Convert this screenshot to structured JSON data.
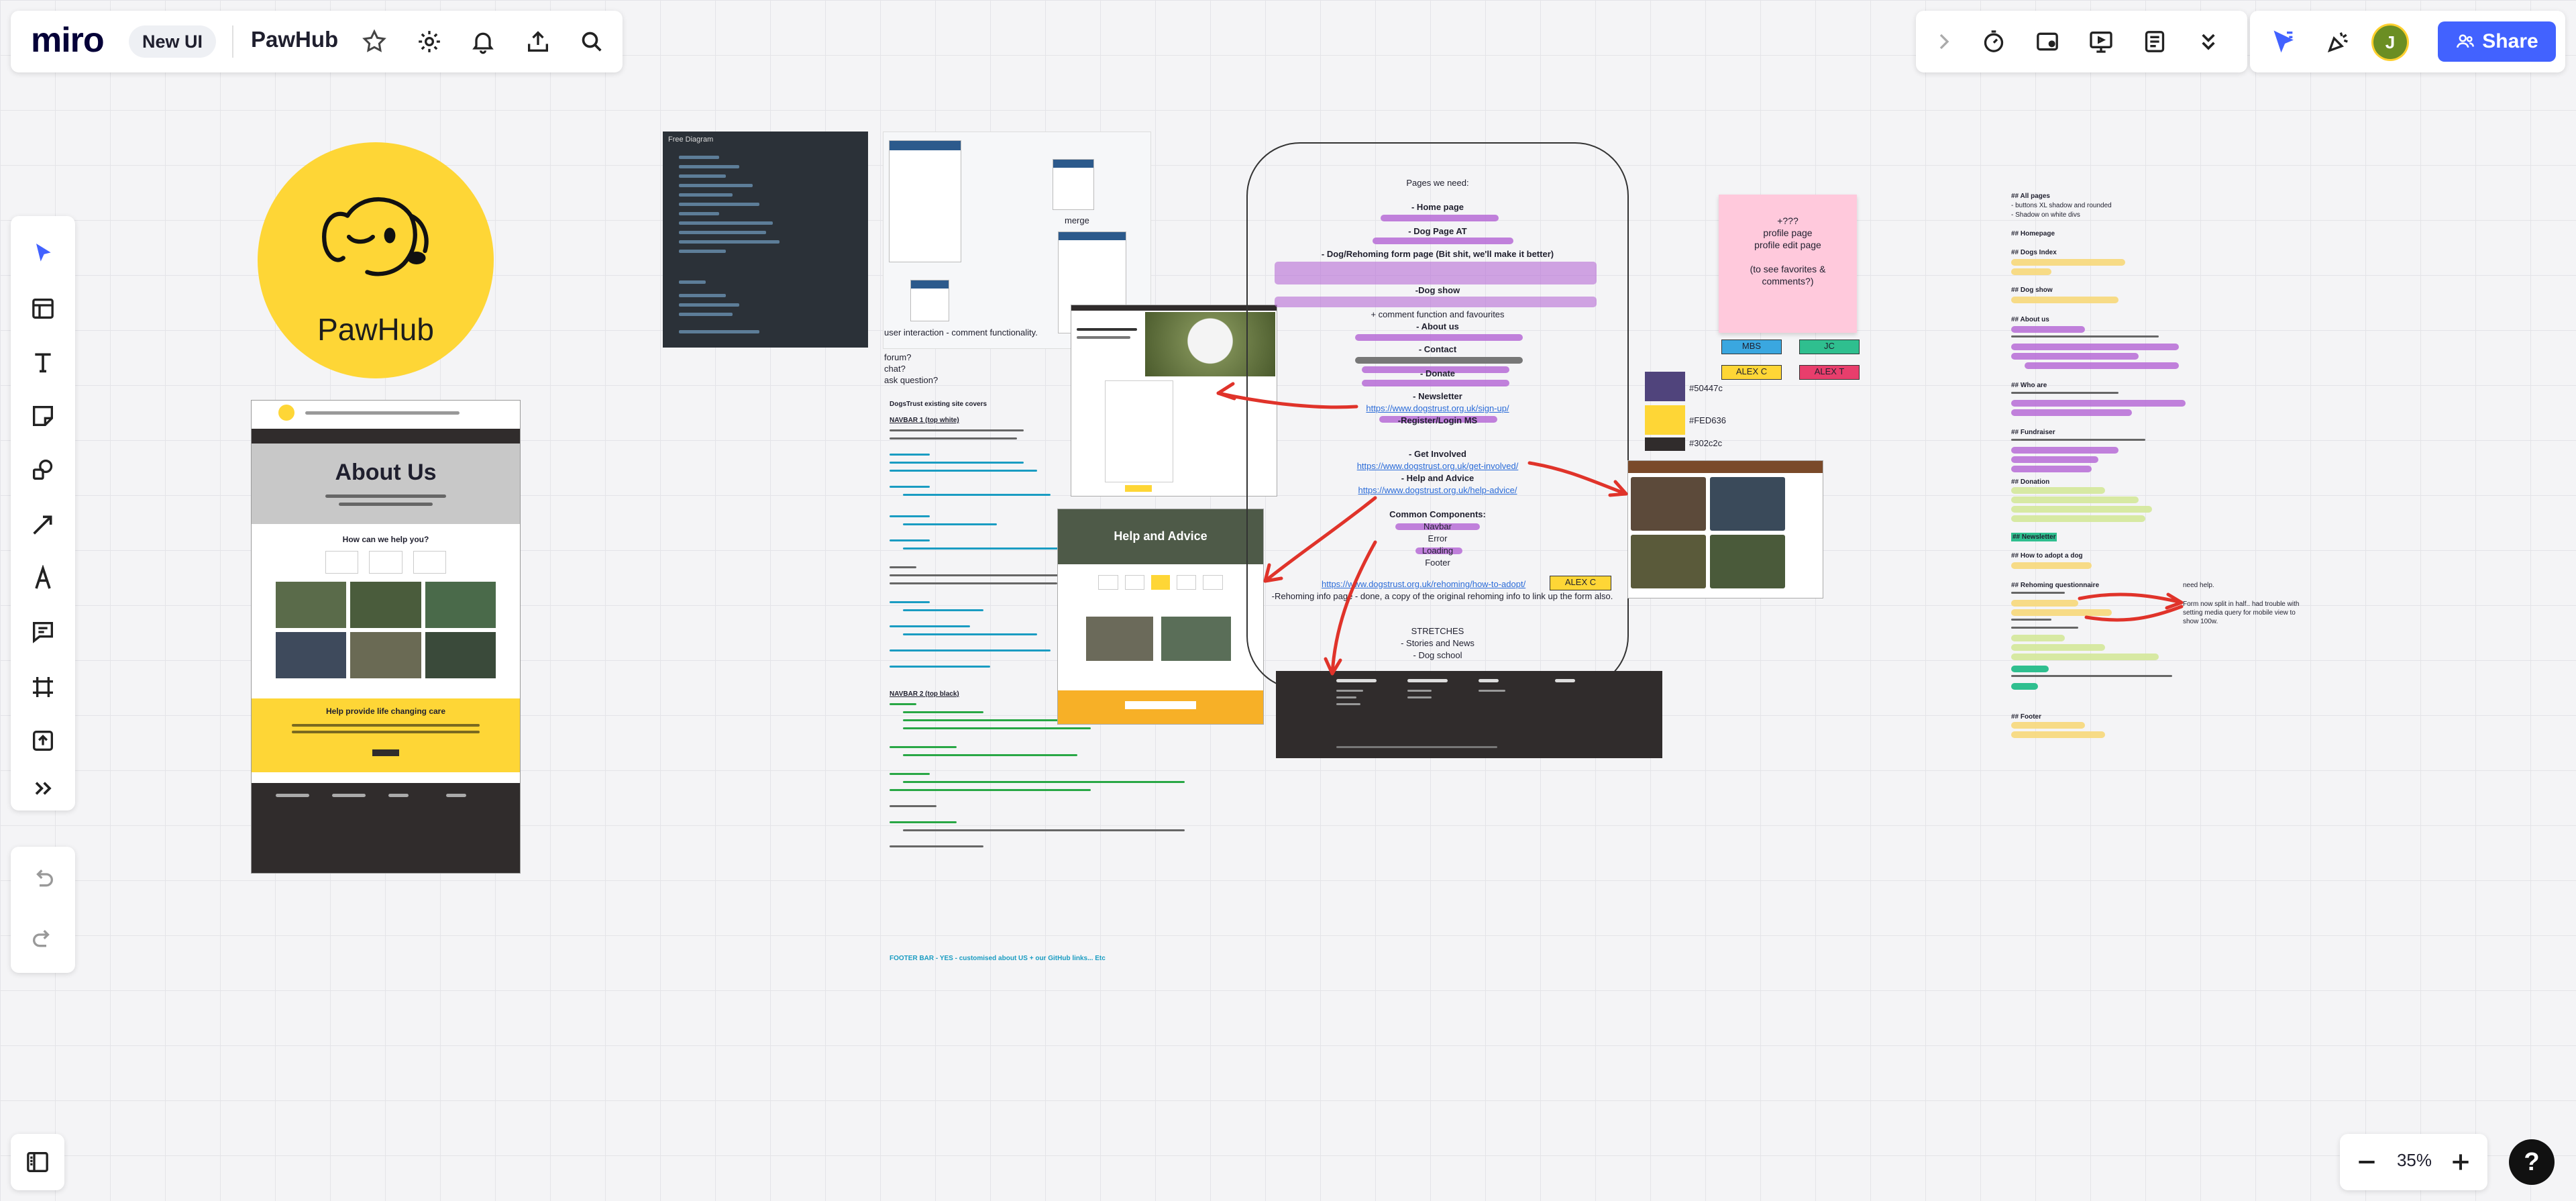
{
  "topbar": {
    "logo": "miro",
    "new_ui_label": "New UI",
    "board_name": "PawHub"
  },
  "share_label": "Share",
  "avatar_initial": "J",
  "zoom": "35%",
  "help_label": "?",
  "colors": {
    "accent": "#4262ff",
    "yellow": "#FED636",
    "navy": "#50447c",
    "dark": "#302c2c",
    "red_arrow": "#e0332a"
  },
  "canvas": {
    "logo_text": "PawHub",
    "about": {
      "title": "About Us",
      "subtitle": "How can we help you?",
      "banner": "Help provide life changing care"
    },
    "free_diagram": {
      "title": "Free Diagram"
    },
    "diagram_caption": "user interaction - comment functionality.",
    "diagram_merge": "merge",
    "forum_notes": [
      "forum?",
      "chat?",
      "ask question?"
    ],
    "help_advice_title": "Help and Advice",
    "pages_box": {
      "heading": "Pages we need:",
      "items": [
        "- Home page",
        "- Dog Page AT",
        "- Dog/Rehoming form page (Bit shit, we'll make it better)",
        "-Dog show",
        "+ comment function and favourites",
        "- About us",
        "- Contact",
        "- Donate",
        "- Newsletter",
        "https://www.dogstrust.org.uk/sign-up/",
        "-Register/Login MS",
        "- Get Involved",
        "https://www.dogstrust.org.uk/get-involved/",
        "- Help and Advice",
        "https://www.dogstrust.org.uk/help-advice/",
        "Common Components:",
        "Navbar",
        "Error",
        "Loading",
        "Footer",
        "https://www.dogstrust.org.uk/rehoming/how-to-adopt/",
        "-Rehoming info page - done, a copy of the original rehoming info to link up the form also.",
        "STRETCHES",
        "- Stories and News",
        "- Dog school"
      ],
      "alex_tag": "ALEX C"
    },
    "sticky": {
      "lines": [
        "+???",
        "profile page",
        "profile edit page",
        "",
        "(to see favorites &",
        "comments?)"
      ]
    },
    "name_tags": [
      "MBS",
      "JC",
      "ALEX C",
      "ALEX T"
    ],
    "swatches": [
      "#50447c",
      "#FED636",
      "#302c2c"
    ],
    "right_notes": {
      "items": [
        "## All pages",
        "- buttons XL shadow and rounded",
        "- Shadow on white divs",
        "## Homepage",
        "## Dogs Index",
        "## Dog show",
        "## About us",
        "## Who are",
        "## Fundraiser",
        "## Donation",
        "## Newsletter",
        "## How to adopt a dog",
        "## Rehoming questionnaire",
        "## Footer"
      ],
      "need_help": "need help.",
      "split_note": "Form now split in half.. had trouble with setting media query for mobile view to show 100w."
    },
    "middle_notes": {
      "title": "DogsTrust existing site covers",
      "navbar1": "NAVBAR 1 (top white)",
      "navbar2": "NAVBAR 2 (top black)",
      "footer_bar": "FOOTER BAR - YES - customised about US + our GitHub links... Etc"
    }
  }
}
